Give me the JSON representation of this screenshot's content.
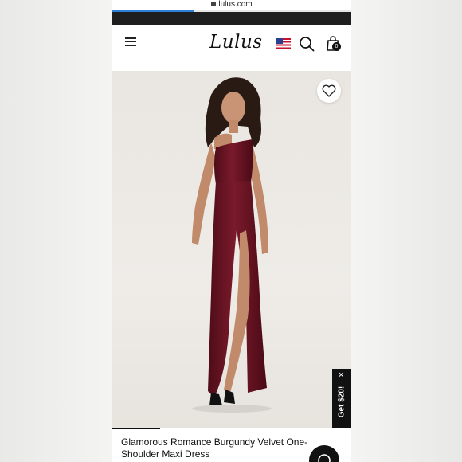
{
  "browser": {
    "url": "lulus.com",
    "load_progress": 0.34
  },
  "header": {
    "logo": "Lulus",
    "cart_count": "0",
    "icons": [
      "menu-icon",
      "us-flag-icon",
      "search-icon",
      "shopping-bag-icon"
    ]
  },
  "product": {
    "title": "Glamorous Romance Burgundy Velvet One-Shoulder Maxi Dress",
    "dress_color": "#6b1424"
  },
  "promo": {
    "label": "Get $20!"
  },
  "colors": {
    "accent": "#2f7fd6",
    "dark": "#111111"
  }
}
